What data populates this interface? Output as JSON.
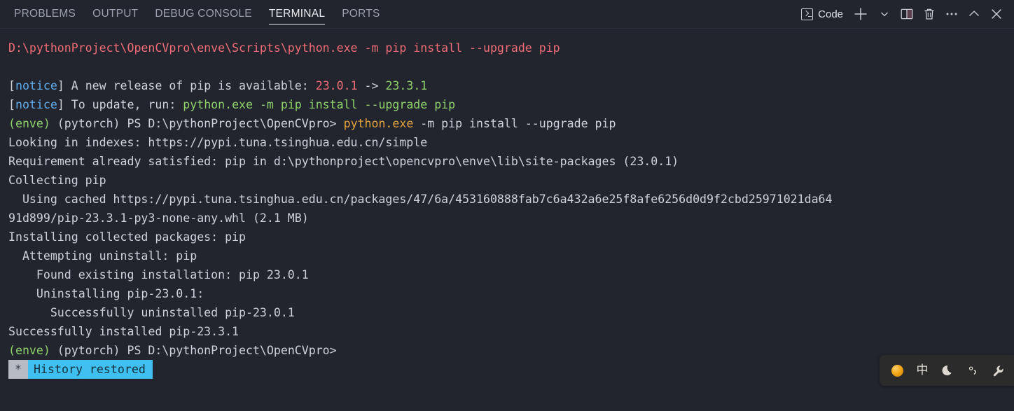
{
  "panel": {
    "tabs": [
      {
        "label": "PROBLEMS",
        "active": false
      },
      {
        "label": "OUTPUT",
        "active": false
      },
      {
        "label": "DEBUG CONSOLE",
        "active": false
      },
      {
        "label": "TERMINAL",
        "active": true
      },
      {
        "label": "PORTS",
        "active": false
      }
    ]
  },
  "toolbar": {
    "terminal_icon": "terminal-icon",
    "shell_label": "Code",
    "new_terminal_icon": "plus-icon",
    "new_terminal_dropdown_icon": "chevron-down-icon",
    "split_terminal_icon": "split-panel-icon",
    "kill_terminal_icon": "trash-icon",
    "more_actions_icon": "ellipsis-icon",
    "maximize_panel_icon": "chevron-up-icon",
    "close_panel_icon": "close-icon"
  },
  "terminal": {
    "lines": [
      {
        "id": "command-echo",
        "segments": [
          {
            "text": "D:\\pythonProject\\OpenCVpro\\enve\\Scripts\\python.exe -m pip install --upgrade pip",
            "color": "red"
          }
        ]
      },
      {
        "id": "blank-1",
        "segments": [
          {
            "text": " ",
            "color": "gray"
          }
        ]
      },
      {
        "id": "notice-release",
        "segments": [
          {
            "text": "[",
            "color": "gray"
          },
          {
            "text": "notice",
            "color": "blue"
          },
          {
            "text": "] A new release of pip is available: ",
            "color": "gray"
          },
          {
            "text": "23.0.1",
            "color": "red"
          },
          {
            "text": " -> ",
            "color": "gray"
          },
          {
            "text": "23.3.1",
            "color": "green"
          }
        ]
      },
      {
        "id": "notice-update",
        "segments": [
          {
            "text": "[",
            "color": "gray"
          },
          {
            "text": "notice",
            "color": "blue"
          },
          {
            "text": "] To update, run: ",
            "color": "gray"
          },
          {
            "text": "python.exe -m pip install --upgrade pip",
            "color": "green"
          }
        ]
      },
      {
        "id": "prompt-command",
        "segments": [
          {
            "text": "(enve)",
            "color": "green"
          },
          {
            "text": " (pytorch) PS D:\\pythonProject\\OpenCVpro> ",
            "color": "gray"
          },
          {
            "text": "python.exe",
            "color": "orange"
          },
          {
            "text": " -m pip install --upgrade pip",
            "color": "gray"
          }
        ]
      },
      {
        "id": "looking-in-indexes",
        "segments": [
          {
            "text": "Looking in indexes: https://pypi.tuna.tsinghua.edu.cn/simple",
            "color": "gray"
          }
        ]
      },
      {
        "id": "requirement-satisfied",
        "segments": [
          {
            "text": "Requirement already satisfied: pip in d:\\pythonproject\\opencvpro\\enve\\lib\\site-packages (23.0.1)",
            "color": "gray"
          }
        ]
      },
      {
        "id": "collecting-pip",
        "segments": [
          {
            "text": "Collecting pip",
            "color": "gray"
          }
        ]
      },
      {
        "id": "using-cached",
        "segments": [
          {
            "text": "  Using cached https://pypi.tuna.tsinghua.edu.cn/packages/47/6a/453160888fab7c6a432a6e25f8afe6256d0d9f2cbd25971021da64",
            "color": "gray"
          }
        ]
      },
      {
        "id": "using-cached-wrap",
        "segments": [
          {
            "text": "91d899/pip-23.3.1-py3-none-any.whl (2.1 MB)",
            "color": "gray"
          }
        ]
      },
      {
        "id": "installing-collected",
        "segments": [
          {
            "text": "Installing collected packages: pip",
            "color": "gray"
          }
        ]
      },
      {
        "id": "attempting-uninstall",
        "segments": [
          {
            "text": "  Attempting uninstall: pip",
            "color": "gray"
          }
        ]
      },
      {
        "id": "found-existing",
        "segments": [
          {
            "text": "    Found existing installation: pip 23.0.1",
            "color": "gray"
          }
        ]
      },
      {
        "id": "uninstalling",
        "segments": [
          {
            "text": "    Uninstalling pip-23.0.1:",
            "color": "gray"
          }
        ]
      },
      {
        "id": "successfully-uninstalled",
        "segments": [
          {
            "text": "      Successfully uninstalled pip-23.0.1",
            "color": "gray"
          }
        ]
      },
      {
        "id": "successfully-installed",
        "segments": [
          {
            "text": "Successfully installed pip-23.3.1",
            "color": "gray"
          }
        ]
      },
      {
        "id": "prompt-final",
        "segments": [
          {
            "text": "(enve)",
            "color": "green"
          },
          {
            "text": " (pytorch) PS D:\\pythonProject\\OpenCVpro>",
            "color": "gray"
          }
        ]
      }
    ],
    "history_banner": {
      "star": "*",
      "label": "History restored"
    }
  },
  "ime": {
    "logo_icon": "sogou-logo-icon",
    "language_label": "中",
    "mode_icon": "crescent-moon-icon",
    "punctuation_icon": "punctuation-icon",
    "settings_icon": "wrench-icon"
  }
}
